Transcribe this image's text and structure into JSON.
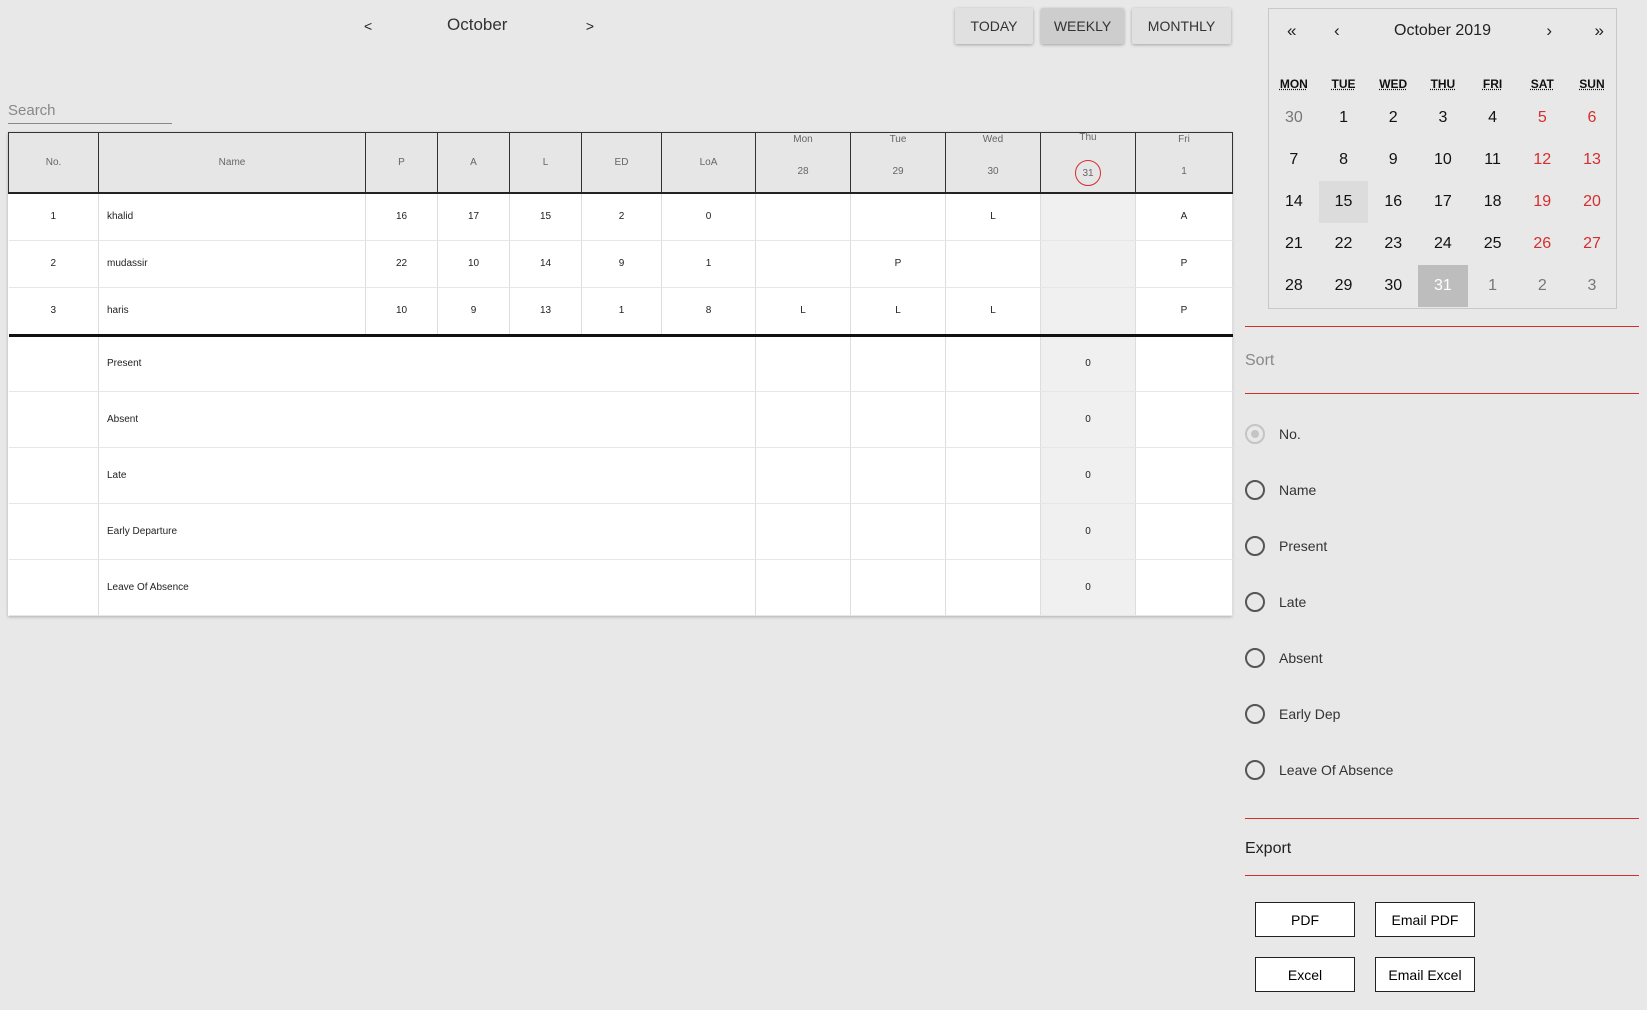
{
  "nav": {
    "prev": "<",
    "next": ">",
    "month": "October"
  },
  "views": {
    "today": "TODAY",
    "weekly": "WEEKLY",
    "monthly": "MONTHLY"
  },
  "search": {
    "placeholder": "Search"
  },
  "table": {
    "headers": {
      "no": "No.",
      "name": "Name",
      "p": "P",
      "a": "A",
      "l": "L",
      "ed": "ED",
      "loa": "LoA"
    },
    "days": [
      {
        "name": "Mon",
        "num": "28"
      },
      {
        "name": "Tue",
        "num": "29"
      },
      {
        "name": "Wed",
        "num": "30"
      },
      {
        "name": "Thu",
        "num": "31"
      },
      {
        "name": "Fri",
        "num": "1"
      }
    ],
    "rows": [
      {
        "no": "1",
        "name": "khalid",
        "p": "16",
        "a": "17",
        "l": "15",
        "ed": "2",
        "loa": "0",
        "d": [
          "",
          "",
          "L",
          "",
          "A"
        ]
      },
      {
        "no": "2",
        "name": "mudassir",
        "p": "22",
        "a": "10",
        "l": "14",
        "ed": "9",
        "loa": "1",
        "d": [
          "",
          "P",
          "",
          "",
          "P"
        ]
      },
      {
        "no": "3",
        "name": "haris",
        "p": "10",
        "a": "9",
        "l": "13",
        "ed": "1",
        "loa": "8",
        "d": [
          "L",
          "L",
          "L",
          "",
          "P"
        ]
      }
    ],
    "summary": [
      {
        "label": "Present",
        "d": [
          "",
          "",
          "",
          "0",
          ""
        ]
      },
      {
        "label": "Absent",
        "d": [
          "",
          "",
          "",
          "0",
          ""
        ]
      },
      {
        "label": "Late",
        "d": [
          "",
          "",
          "",
          "0",
          ""
        ]
      },
      {
        "label": "Early Departure",
        "d": [
          "",
          "",
          "",
          "0",
          ""
        ]
      },
      {
        "label": "Leave Of Absence",
        "d": [
          "",
          "",
          "",
          "0",
          ""
        ]
      }
    ]
  },
  "calendar": {
    "title": "October 2019",
    "prev_year": "«",
    "prev_month": "‹",
    "next_month": "›",
    "next_year": "»",
    "dow": [
      "MON",
      "TUE",
      "WED",
      "THU",
      "FRI",
      "SAT",
      "SUN"
    ],
    "weeks": [
      [
        "30",
        "1",
        "2",
        "3",
        "4",
        "5",
        "6"
      ],
      [
        "7",
        "8",
        "9",
        "10",
        "11",
        "12",
        "13"
      ],
      [
        "14",
        "15",
        "16",
        "17",
        "18",
        "19",
        "20"
      ],
      [
        "21",
        "22",
        "23",
        "24",
        "25",
        "26",
        "27"
      ],
      [
        "28",
        "29",
        "30",
        "31",
        "1",
        "2",
        "3"
      ]
    ]
  },
  "sort": {
    "title": "Sort",
    "options": [
      "No.",
      "Name",
      "Present",
      "Late",
      "Absent",
      "Early Dep",
      "Leave Of Absence"
    ],
    "selected": "No."
  },
  "export": {
    "title": "Export",
    "buttons": [
      "PDF",
      "Email PDF",
      "Excel",
      "Email Excel"
    ]
  },
  "colors": {
    "accent": "#d32f2f",
    "background": "#e8e8e8"
  }
}
